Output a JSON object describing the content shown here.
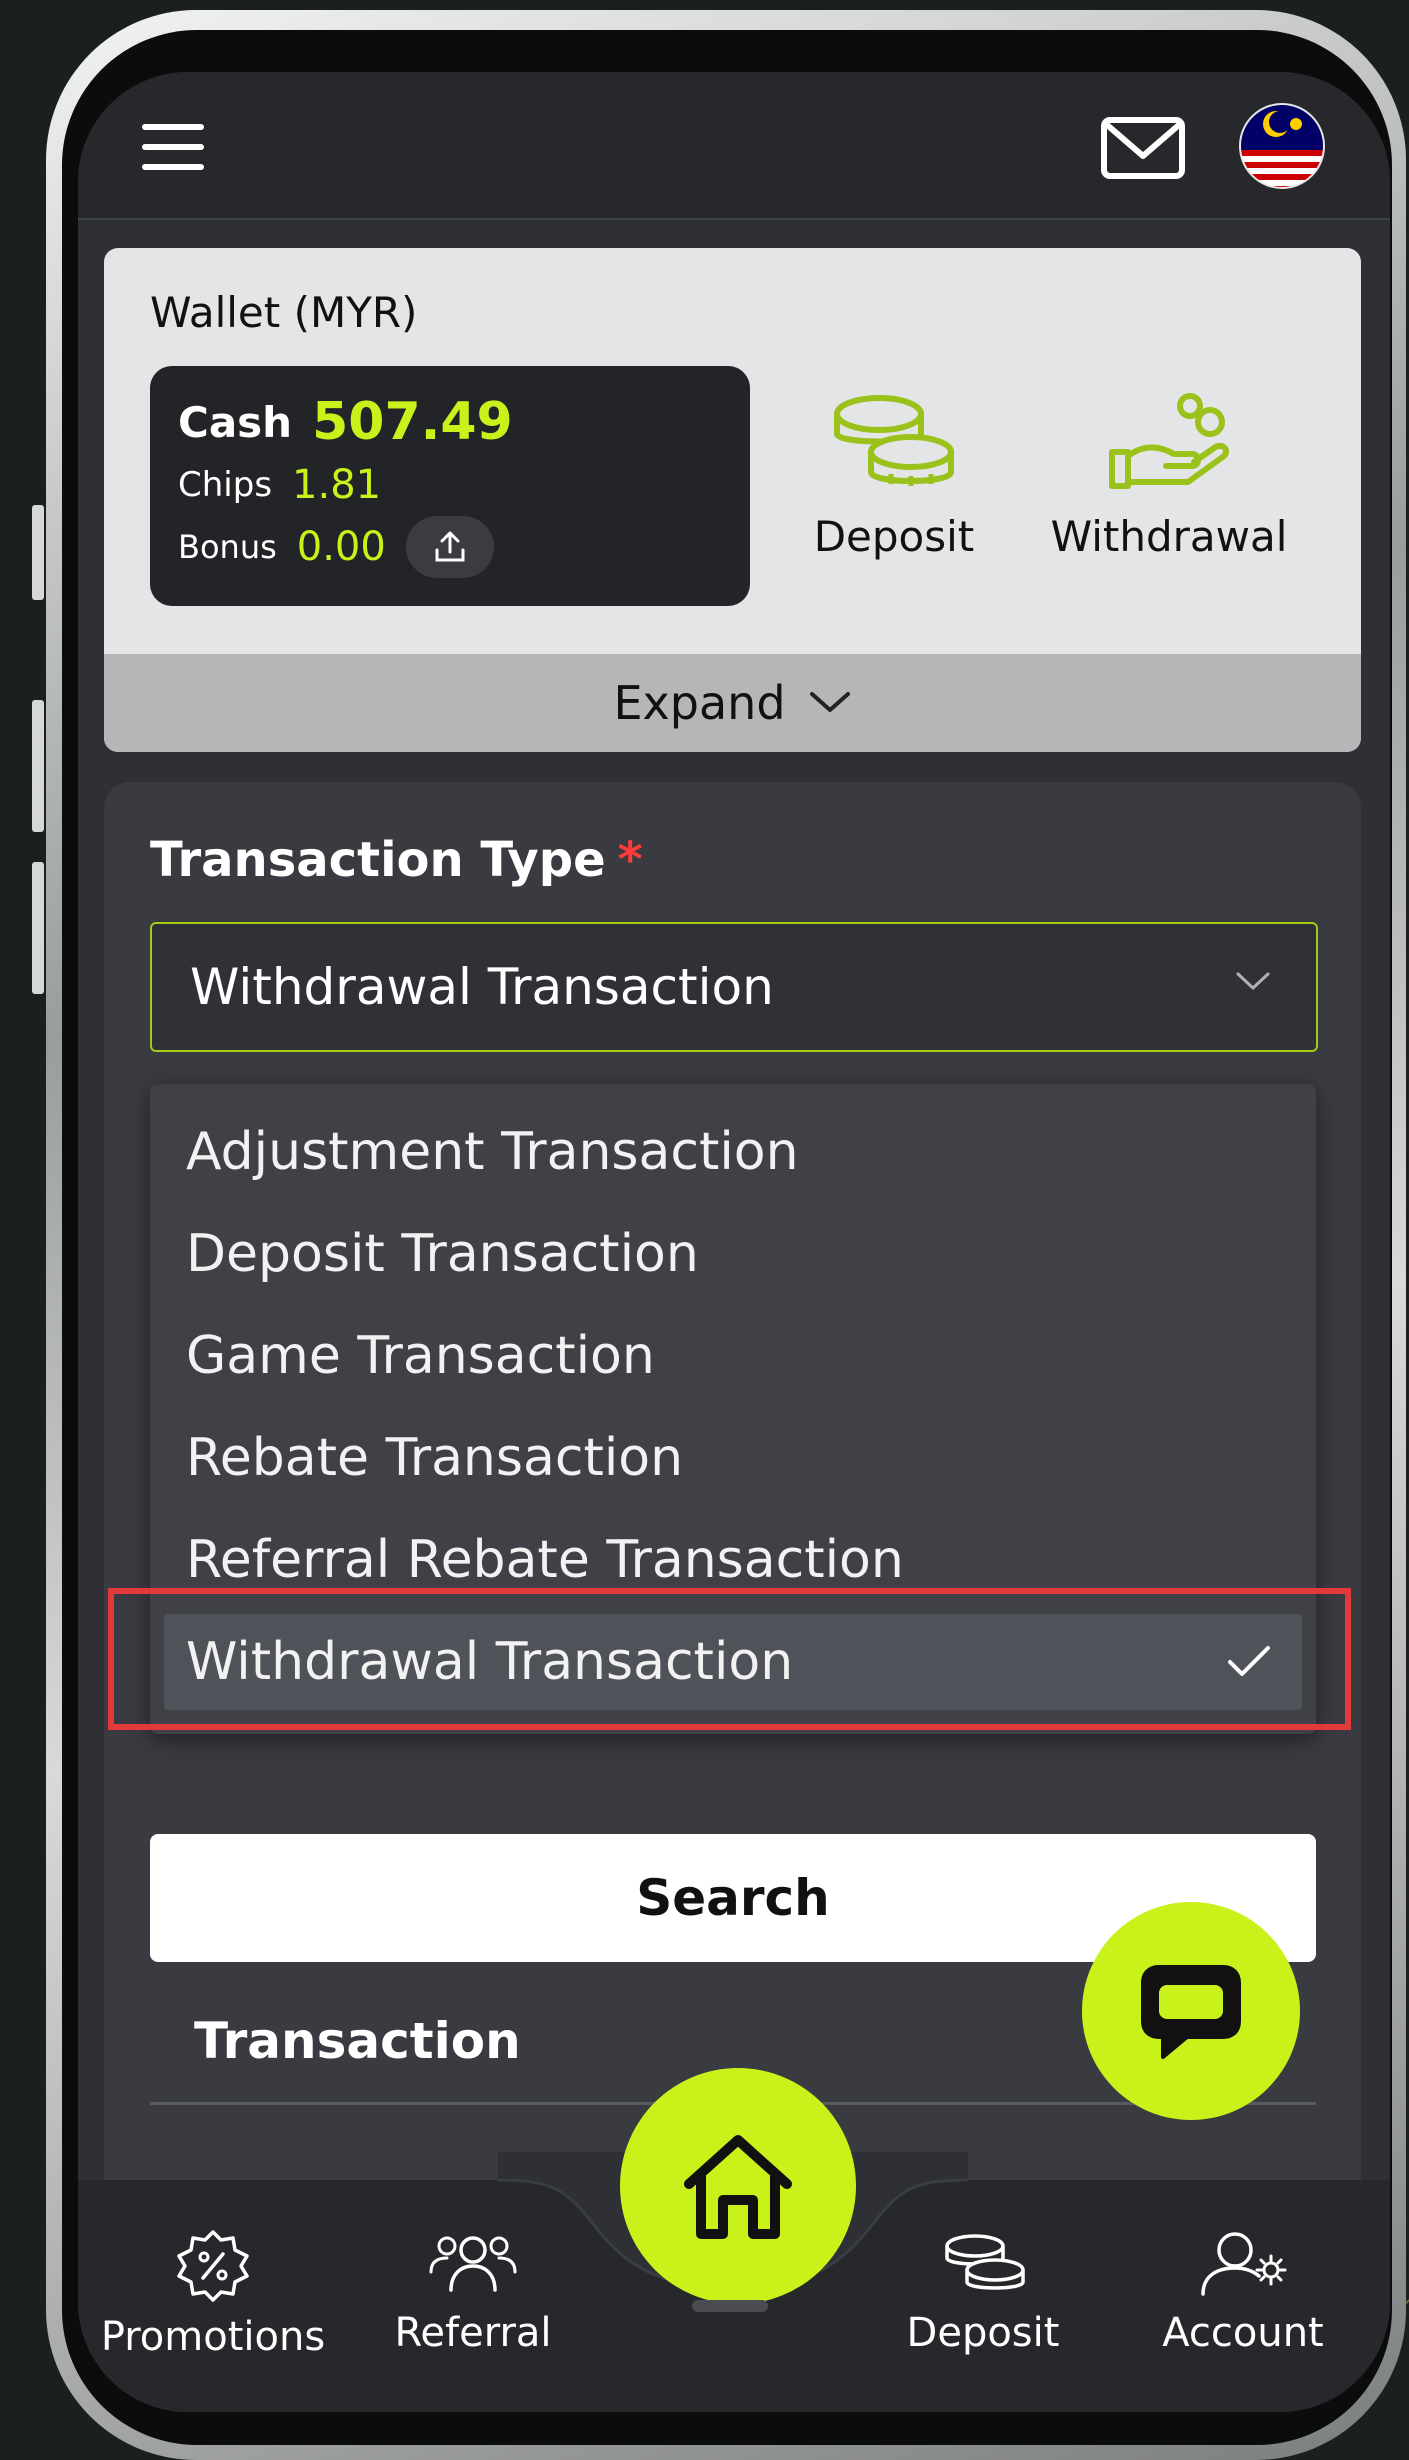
{
  "header": {
    "menu_icon": "hamburger-icon",
    "mail_icon": "mail-icon",
    "language_icon": "malaysia-flag-icon"
  },
  "wallet": {
    "title": "Wallet (MYR)",
    "cash_label": "Cash",
    "cash_value": "507.49",
    "chips_label": "Chips",
    "chips_value": "1.81",
    "bonus_label": "Bonus",
    "bonus_value": "0.00",
    "deposit_label": "Deposit",
    "withdrawal_label": "Withdrawal",
    "expand_label": "Expand"
  },
  "filter": {
    "label": "Transaction Type",
    "required_mark": "*",
    "selected_value": "Withdrawal Transaction",
    "options": [
      {
        "label": "Adjustment Transaction",
        "selected": false
      },
      {
        "label": "Deposit Transaction",
        "selected": false
      },
      {
        "label": "Game Transaction",
        "selected": false
      },
      {
        "label": "Rebate Transaction",
        "selected": false
      },
      {
        "label": "Referral Rebate Transaction",
        "selected": false
      },
      {
        "label": "Withdrawal Transaction",
        "selected": true
      }
    ],
    "search_label": "Search"
  },
  "transaction": {
    "heading": "Transaction"
  },
  "bottom_nav": {
    "items": [
      {
        "label": "Promotions",
        "icon": "promotions-badge-icon"
      },
      {
        "label": "Referral",
        "icon": "referral-users-icon"
      },
      {
        "label": "Deposit",
        "icon": "deposit-coins-icon"
      },
      {
        "label": "Account",
        "icon": "account-settings-icon"
      }
    ],
    "home_icon": "home-icon"
  },
  "colors": {
    "accent": "#c9f21b",
    "highlight_border": "#e23a3a",
    "card_bg": "#393b41",
    "topbar_bg": "#26282b"
  }
}
